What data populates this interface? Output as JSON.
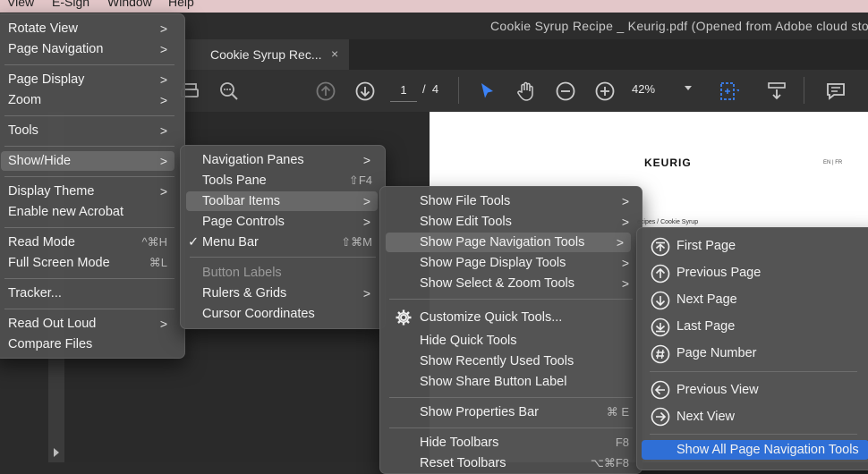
{
  "menubar": {
    "items": [
      "View",
      "E-Sign",
      "Window",
      "Help"
    ]
  },
  "window": {
    "title": "Cookie Syrup Recipe _ Keurig.pdf (Opened from Adobe cloud stor"
  },
  "tab": {
    "label": "Cookie Syrup Rec...",
    "close": "×"
  },
  "toolbar": {
    "page_current": "1",
    "page_separator": "/",
    "page_total": "4",
    "zoom": "42%"
  },
  "document": {
    "brand": "KEURIG",
    "lang": "EN | FR",
    "breadcrumb_fragment": "ecipes / Cookie Syrup"
  },
  "view_menu": {
    "items": [
      {
        "label": "Rotate View",
        "submenu": ">"
      },
      {
        "label": "Page Navigation",
        "submenu": ">"
      },
      {
        "label": "Page Display",
        "submenu": ">"
      },
      {
        "label": "Zoom",
        "submenu": ">"
      },
      {
        "label": "Tools",
        "submenu": ">"
      },
      {
        "label": "Show/Hide",
        "submenu": ">"
      },
      {
        "label": "Display Theme",
        "submenu": ">"
      },
      {
        "label": "Enable new Acrobat"
      },
      {
        "label": "Read Mode",
        "shortcut": "^⌘H"
      },
      {
        "label": "Full Screen Mode",
        "shortcut": "⌘L"
      },
      {
        "label": "Tracker..."
      },
      {
        "label": "Read Out Loud",
        "submenu": ">"
      },
      {
        "label": "Compare Files"
      }
    ]
  },
  "showhide_menu": {
    "items": [
      {
        "label": "Navigation Panes",
        "submenu": ">"
      },
      {
        "label": "Tools Pane",
        "shortcut": "⇧F4"
      },
      {
        "label": "Toolbar Items",
        "submenu": ">"
      },
      {
        "label": "Page Controls",
        "submenu": ">"
      },
      {
        "label": "Menu Bar",
        "check": "✓",
        "shortcut": "⇧⌘M"
      },
      {
        "label": "Button Labels"
      },
      {
        "label": "Rulers & Grids",
        "submenu": ">"
      },
      {
        "label": "Cursor Coordinates"
      }
    ]
  },
  "toolbar_items_menu": {
    "items": [
      {
        "label": "Show File Tools",
        "submenu": ">"
      },
      {
        "label": "Show Edit Tools",
        "submenu": ">"
      },
      {
        "label": "Show Page Navigation Tools",
        "submenu": ">"
      },
      {
        "label": "Show Page Display Tools",
        "submenu": ">"
      },
      {
        "label": "Show Select & Zoom Tools",
        "submenu": ">"
      },
      {
        "label": "Customize Quick Tools..."
      },
      {
        "label": "Hide Quick Tools"
      },
      {
        "label": "Show Recently Used Tools"
      },
      {
        "label": "Show Share Button Label"
      },
      {
        "label": "Show Properties Bar",
        "shortcut": "⌘ E"
      },
      {
        "label": "Hide Toolbars",
        "shortcut": "F8"
      },
      {
        "label": "Reset Toolbars",
        "shortcut": "⌥⌘F8"
      }
    ]
  },
  "page_nav_menu": {
    "items": [
      {
        "label": "First Page",
        "icon": "first-page-icon"
      },
      {
        "label": "Previous Page",
        "icon": "previous-page-icon"
      },
      {
        "label": "Next Page",
        "icon": "next-page-icon"
      },
      {
        "label": "Last Page",
        "icon": "last-page-icon"
      },
      {
        "label": "Page Number",
        "icon": "page-number-icon"
      },
      {
        "label": "Previous View",
        "icon": "previous-view-icon"
      },
      {
        "label": "Next View",
        "icon": "next-view-icon"
      },
      {
        "label": "Show All Page Navigation Tools"
      }
    ]
  },
  "colors": {
    "highlight": "#2f6fd6",
    "menu_bg": "#4e4e4e",
    "selection_tool": "#3b82f6"
  }
}
